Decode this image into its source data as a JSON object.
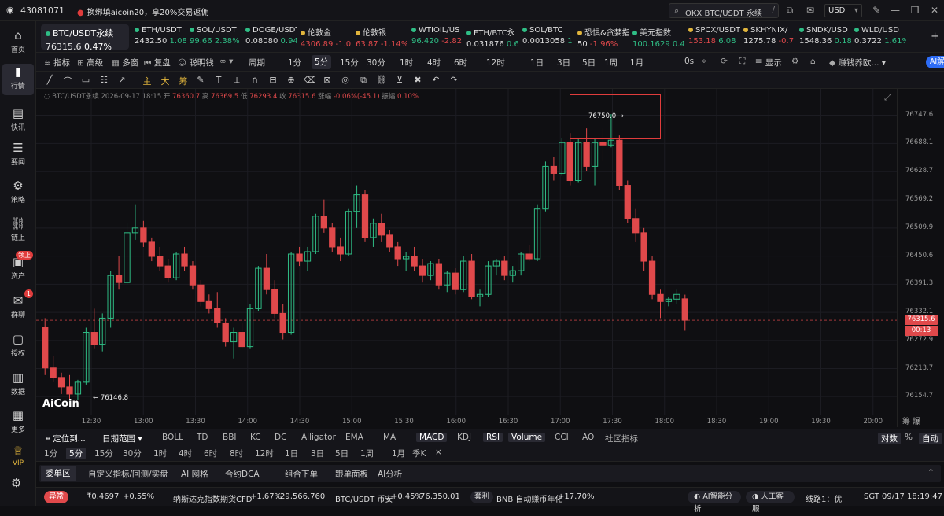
{
  "titlebar": {
    "app_id": "43081071",
    "promo": "换绑填aicoin20，享20%交易返佣",
    "search": "OKX BTC/USDT 永续",
    "currency": "USD"
  },
  "sidebar": [
    {
      "label": "首页",
      "icon": "home-icon"
    },
    {
      "label": "行情",
      "icon": "chart-icon"
    },
    {
      "label": "快讯",
      "icon": "news-icon"
    },
    {
      "label": "要闻",
      "icon": "headline-icon"
    },
    {
      "label": "策略",
      "icon": "robot-icon"
    },
    {
      "label": "链上",
      "icon": "chain-icon"
    },
    {
      "label": "资产",
      "icon": "wallet-icon",
      "badge": "领上"
    },
    {
      "label": "群聊",
      "icon": "mail-icon",
      "badge": "1"
    },
    {
      "label": "授权",
      "icon": "auth-icon"
    },
    {
      "label": "数据",
      "icon": "data-icon"
    },
    {
      "label": "更多",
      "icon": "grid-icon"
    },
    {
      "label": "VIP",
      "icon": "vip-icon"
    }
  ],
  "ticker": [
    {
      "name": "BTC/USDT永续",
      "price": "76315.6",
      "change": "0.47%",
      "dir": "up"
    },
    {
      "name": "ETH/USDT",
      "price": "2432.50",
      "change": "1.08",
      "dir": "up"
    },
    {
      "name": "SOL/USDT",
      "price": "99.66",
      "change": "2.38%",
      "dir": "up"
    },
    {
      "name": "DOGE/USDT",
      "price": "0.08080",
      "change": "0.94",
      "dir": "up"
    },
    {
      "name": "伦敦金",
      "price": "4306.89",
      "change": "-1.0",
      "dir": "dn"
    },
    {
      "name": "伦敦银",
      "price": "63.87",
      "change": "-1.14%",
      "dir": "dn"
    },
    {
      "name": "WTIOIL/US",
      "price": "96.420",
      "change": "-2.82",
      "dir": "up"
    },
    {
      "name": "ETH/BTC永",
      "price": "0.031876",
      "change": "0.6",
      "dir": "up"
    },
    {
      "name": "SOL/BTC",
      "price": "0.0013058",
      "change": "1",
      "dir": "up"
    },
    {
      "name": "恐惧&贪婪指数",
      "price": "50",
      "change": "-1.96%",
      "dir": "dn"
    },
    {
      "name": "美元指数",
      "price": "100.1629",
      "change": "0.4",
      "dir": "up"
    },
    {
      "name": "SPCX/USDT",
      "price": "153.18",
      "change": "6.08",
      "dir": "dn"
    },
    {
      "name": "SKHYNIX/",
      "price": "1275.78",
      "change": "-0.7",
      "dir": "dn"
    },
    {
      "name": "SNDK/USD",
      "price": "1548.36",
      "change": "0.18",
      "dir": "up"
    },
    {
      "name": "WLD/USD",
      "price": "0.3722",
      "change": "1.61%",
      "dir": "up"
    }
  ],
  "toolbar1": {
    "items": [
      "指标",
      "高级",
      "多窗",
      "复盘",
      "聪明钱",
      "周期",
      "1分",
      "5分",
      "15分",
      "30分",
      "1时",
      "4时",
      "6时",
      "12时",
      "1日",
      "3日",
      "5日",
      "1周",
      "1月"
    ],
    "selected": "5分",
    "right": [
      "0s",
      "显示",
      "赚钱养欧...",
      "AI解读"
    ]
  },
  "toolbar2": {
    "tools": [
      "主",
      "大",
      "筹"
    ]
  },
  "chart_header": {
    "symbol": "BTC/USDT永续",
    "time": "2026-09-17 18:15",
    "open_label": "开",
    "open": "76360.7",
    "high_label": "高",
    "high": "76369.5",
    "low_label": "低",
    "low": "76293.4",
    "close_label": "收",
    "close": "76315.6",
    "chg_label": "涨幅",
    "chg": "-0.06%(-45.1)",
    "amp_label": "振幅",
    "amp": "0.10%"
  },
  "chart_labels": {
    "high_marker": "76750.0",
    "low_marker": "76146.8",
    "current_price": "76315.6",
    "countdown": "00:13",
    "logo": "AiCoin"
  },
  "chart_data": {
    "type": "candlestick",
    "y_ticks": [
      "76747.6",
      "76688.1",
      "76628.7",
      "76569.2",
      "76509.9",
      "76450.6",
      "76391.3",
      "76332.1",
      "76272.9",
      "76213.7",
      "76154.7"
    ],
    "x_ticks": [
      "12:30",
      "13:00",
      "13:30",
      "14:00",
      "14:30",
      "15:00",
      "15:30",
      "16:00",
      "16:30",
      "17:00",
      "17:30",
      "18:00",
      "18:30",
      "19:00",
      "19:30",
      "20:00"
    ],
    "ylim": [
      76140,
      76770
    ],
    "candles": [
      [
        76300,
        76320,
        76200,
        76215
      ],
      [
        76215,
        76240,
        76185,
        76195
      ],
      [
        76195,
        76205,
        76160,
        76175
      ],
      [
        76175,
        76200,
        76150,
        76160
      ],
      [
        76160,
        76190,
        76146.8,
        76185
      ],
      [
        76185,
        76300,
        76180,
        76290
      ],
      [
        76290,
        76340,
        76255,
        76265
      ],
      [
        76265,
        76330,
        76250,
        76320
      ],
      [
        76320,
        76420,
        76300,
        76410
      ],
      [
        76410,
        76450,
        76380,
        76395
      ],
      [
        76395,
        76520,
        76390,
        76500
      ],
      [
        76500,
        76560,
        76485,
        76510
      ],
      [
        76510,
        76525,
        76470,
        76480
      ],
      [
        76480,
        76490,
        76440,
        76450
      ],
      [
        76450,
        76470,
        76420,
        76430
      ],
      [
        76430,
        76445,
        76395,
        76405
      ],
      [
        76405,
        76460,
        76400,
        76455
      ],
      [
        76455,
        76470,
        76420,
        76430
      ],
      [
        76430,
        76440,
        76380,
        76390
      ],
      [
        76390,
        76400,
        76345,
        76355
      ],
      [
        76355,
        76370,
        76330,
        76340
      ],
      [
        76340,
        76375,
        76300,
        76310
      ],
      [
        76310,
        76320,
        76260,
        76270
      ],
      [
        76270,
        76300,
        76235,
        76290
      ],
      [
        76290,
        76310,
        76255,
        76260
      ],
      [
        76260,
        76350,
        76255,
        76340
      ],
      [
        76340,
        76430,
        76335,
        76425
      ],
      [
        76425,
        76455,
        76370,
        76380
      ],
      [
        76380,
        76400,
        76320,
        76330
      ],
      [
        76330,
        76350,
        76275,
        76290
      ],
      [
        76290,
        76460,
        76285,
        76455
      ],
      [
        76455,
        76470,
        76430,
        76440
      ],
      [
        76440,
        76470,
        76420,
        76460
      ],
      [
        76460,
        76540,
        76455,
        76535
      ],
      [
        76535,
        76570,
        76500,
        76510
      ],
      [
        76510,
        76520,
        76460,
        76470
      ],
      [
        76470,
        76490,
        76440,
        76455
      ],
      [
        76455,
        76550,
        76450,
        76545
      ],
      [
        76545,
        76600,
        76510,
        76580
      ],
      [
        76580,
        76590,
        76480,
        76490
      ],
      [
        76490,
        76530,
        76470,
        76520
      ],
      [
        76520,
        76540,
        76480,
        76495
      ],
      [
        76495,
        76505,
        76460,
        76470
      ],
      [
        76470,
        76480,
        76430,
        76445
      ],
      [
        76445,
        76460,
        76420,
        76450
      ],
      [
        76450,
        76470,
        76420,
        76430
      ],
      [
        76430,
        76445,
        76395,
        76410
      ],
      [
        76410,
        76440,
        76400,
        76435
      ],
      [
        76435,
        76445,
        76380,
        76390
      ],
      [
        76390,
        76420,
        76375,
        76415
      ],
      [
        76415,
        76425,
        76370,
        76380
      ],
      [
        76380,
        76450,
        76375,
        76440
      ],
      [
        76440,
        76455,
        76360,
        76365
      ],
      [
        76365,
        76380,
        76345,
        76370
      ],
      [
        76370,
        76440,
        76365,
        76430
      ],
      [
        76430,
        76445,
        76410,
        76440
      ],
      [
        76440,
        76450,
        76400,
        76410
      ],
      [
        76410,
        76430,
        76395,
        76420
      ],
      [
        76420,
        76460,
        76410,
        76455
      ],
      [
        76455,
        76475,
        76440,
        76445
      ],
      [
        76445,
        76560,
        76440,
        76550
      ],
      [
        76550,
        76650,
        76545,
        76640
      ],
      [
        76640,
        76660,
        76610,
        76625
      ],
      [
        76625,
        76700,
        76620,
        76690
      ],
      [
        76690,
        76710,
        76600,
        76610
      ],
      [
        76610,
        76700,
        76605,
        76690
      ],
      [
        76690,
        76720,
        76630,
        76640
      ],
      [
        76640,
        76700,
        76600,
        76690
      ],
      [
        76690,
        76720,
        76650,
        76685
      ],
      [
        76685,
        76750,
        76680,
        76695
      ],
      [
        76695,
        76705,
        76590,
        76600
      ],
      [
        76600,
        76610,
        76520,
        76530
      ],
      [
        76530,
        76550,
        76480,
        76500
      ],
      [
        76500,
        76510,
        76420,
        76440
      ],
      [
        76440,
        76450,
        76360,
        76370
      ],
      [
        76370,
        76380,
        76320,
        76355
      ],
      [
        76355,
        76365,
        76345,
        76360
      ],
      [
        76360,
        76380,
        76350,
        76370
      ],
      [
        76360.7,
        76369.5,
        76293.4,
        76315.6
      ]
    ]
  },
  "indicator_row1": {
    "left": [
      "定位到...",
      "日期范围"
    ],
    "main": [
      "BOLL",
      "TD",
      "BBI",
      "KC",
      "DC",
      "Alligator",
      "EMA",
      "MA"
    ],
    "sub": [
      "MACD",
      "KDJ",
      "RSI",
      "Volume",
      "CCI",
      "AO",
      "社区指标"
    ],
    "right": [
      "对数",
      "%",
      "自动"
    ]
  },
  "indicator_row2": {
    "items": [
      "1分",
      "5分",
      "15分",
      "30分",
      "1时",
      "4时",
      "6时",
      "8时",
      "12时",
      "1日",
      "3日",
      "5日",
      "1周",
      "1月",
      "季K",
      "×"
    ],
    "selected": "5分"
  },
  "panel_tabs": {
    "items": [
      "委单区",
      "自定义指标/回测/实盘",
      "AI 网格",
      "合约DCA",
      "组合下单",
      "跟单面板",
      "AI分析"
    ],
    "selected": "委单区"
  },
  "status_bar": {
    "alert": "异常",
    "alert_val": "₹0.4697",
    "alert_chg": "+0.55%",
    "s1_name": "纳斯达克指数期货CFD",
    "s1_chg": "+1.67%",
    "s1_price": "29,566.760",
    "s2_name": "BTC/USDT 币安",
    "s2_chg": "+0.45%",
    "s2_price": "76,350.01",
    "tag": "套利",
    "s3_name": "BNB 自动赚币年化",
    "s3_chg": "+17.70%",
    "ai_btn": "AI智能分析",
    "service": "人工客服",
    "line": "线路1：优",
    "clock": "SGT 09/17 18:19:47"
  },
  "colors": {
    "up": "#2fbd85",
    "down": "#e0494b",
    "accent": "#2d6cf6"
  }
}
